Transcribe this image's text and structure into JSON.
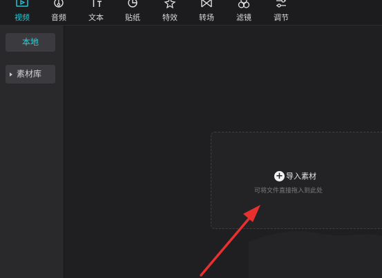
{
  "toolbar": {
    "tabs": [
      {
        "label": "视频",
        "icon": "video-icon",
        "active": true
      },
      {
        "label": "音频",
        "icon": "music-note-icon",
        "active": false
      },
      {
        "label": "文本",
        "icon": "text-icon",
        "active": false
      },
      {
        "label": "贴纸",
        "icon": "sticker-icon",
        "active": false
      },
      {
        "label": "特效",
        "icon": "effects-star-icon",
        "active": false
      },
      {
        "label": "转场",
        "icon": "transition-icon",
        "active": false
      },
      {
        "label": "滤镜",
        "icon": "filter-circles-icon",
        "active": false
      },
      {
        "label": "调节",
        "icon": "adjust-sliders-icon",
        "active": false
      }
    ]
  },
  "sidebar": {
    "local_label": "本地",
    "library_label": "素材库"
  },
  "dropzone": {
    "import_label": "导入素材",
    "hint": "可将文件直接拖入到此处"
  },
  "colors": {
    "accent": "#21c8d6",
    "annotation_arrow": "#e8302f",
    "background": "#1f1f22",
    "sidebar": "#29292c"
  }
}
